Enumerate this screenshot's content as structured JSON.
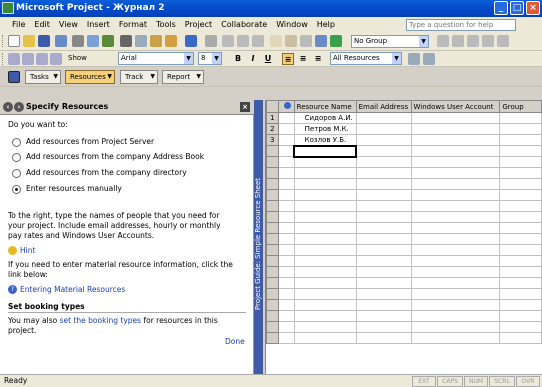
{
  "window": {
    "title": "Microsoft Project - Журнал 2"
  },
  "menu": [
    "File",
    "Edit",
    "View",
    "Insert",
    "Format",
    "Tools",
    "Project",
    "Collaborate",
    "Window",
    "Help"
  ],
  "help_box": {
    "placeholder": "Type a question for help"
  },
  "toolbar1": {
    "group_value": "No Group"
  },
  "toolbar2": {
    "show_label": "Show",
    "font_value": "Arial",
    "size_value": "8",
    "bold": "B",
    "italic": "I",
    "underline": "U",
    "filter_value": "All Resources"
  },
  "guide_toolbar": {
    "buttons": [
      {
        "label": "Tasks",
        "active": false
      },
      {
        "label": "Resources",
        "active": true
      },
      {
        "label": "Track",
        "active": false
      },
      {
        "label": "Report",
        "active": false
      }
    ]
  },
  "task_pane": {
    "title": "Specify Resources",
    "question": "Do you want to:",
    "options": [
      {
        "label": "Add resources from Project Server",
        "selected": false
      },
      {
        "label": "Add resources from the company Address Book",
        "selected": false
      },
      {
        "label": "Add resources from the company directory",
        "selected": false
      },
      {
        "label": "Enter resources manually",
        "selected": true
      }
    ],
    "instruction": [
      "To the right, type the names of people that you need for",
      "your project. Include email addresses, hourly or monthly",
      "pay rates and Windows User Accounts."
    ],
    "hint_label": "Hint",
    "material_text": [
      "If you need to enter material resource information, click the",
      "link below:"
    ],
    "material_link": "Entering Material Resources",
    "booking_heading": "Set booking types",
    "booking_text_before": "You may also",
    "booking_link": "set the booking types",
    "booking_text_after": "for resources in this",
    "booking_text_line2": "project.",
    "done_label": "Done"
  },
  "guide_bar": {
    "label": "Project Guide: Simple Resource Sheet"
  },
  "grid": {
    "columns": [
      "Resource Name",
      "Email Address",
      "Windows User Account",
      "Group"
    ],
    "rows": [
      {
        "num": "1",
        "name": "Сидоров А.И."
      },
      {
        "num": "2",
        "name": "Петров М.К."
      },
      {
        "num": "3",
        "name": "Козлов У.Б."
      }
    ]
  },
  "status": {
    "text": "Ready",
    "indicators": [
      "EXT",
      "CAPS",
      "NUM",
      "SCRL",
      "OVR"
    ]
  }
}
